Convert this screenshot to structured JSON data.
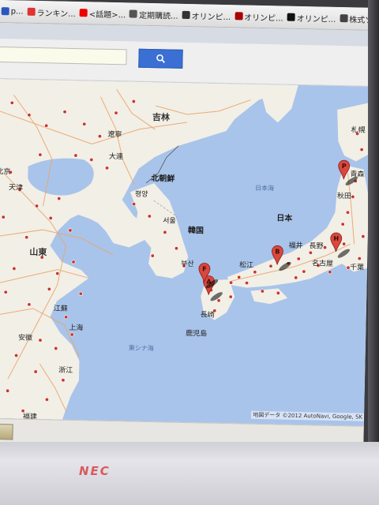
{
  "bookmarks": [
    {
      "label": "p...",
      "color": "#2b56c2"
    },
    {
      "label": "ランキン...",
      "color": "#d33"
    },
    {
      "label": "<話題>...",
      "color": "#e00"
    },
    {
      "label": "定期購読...",
      "color": "#555"
    },
    {
      "label": "オリンピ...",
      "color": "#333"
    },
    {
      "label": "オリンピ...",
      "color": "#a00"
    },
    {
      "label": "オリンピ...",
      "color": "#111"
    },
    {
      "label": "株式ソ...",
      "color": "#444"
    }
  ],
  "titlebar_text": "",
  "search": {
    "value": "",
    "placeholder": "",
    "button_icon": "magnifier-icon"
  },
  "map": {
    "countries": {
      "north_korea": "北朝鮮",
      "korea": "韓国",
      "japan": "日本"
    },
    "seas": {
      "japan_sea": "日本海",
      "east_china_sea": "東シナ海"
    },
    "places": {
      "jilin": "吉林",
      "beijing": "北京",
      "tianjin": "天津",
      "liaoning": "遼寧",
      "dalian": "大連",
      "shandong": "山東",
      "jiangsu": "江蘇",
      "shanghai": "上海",
      "anhui": "安徽",
      "zhejiang": "浙江",
      "fujian": "福建",
      "pyongyang": "평양",
      "seoul": "서울",
      "busan": "부산",
      "nagasaki": "長崎",
      "sapporo": "札幌",
      "aomori": "青森",
      "akita": "秋田",
      "fukui": "福井",
      "nagano": "長野",
      "chiba": "千葉",
      "matsue": "松江",
      "kagoshima": "鹿児島",
      "nagoya": "名古屋"
    },
    "markers": [
      {
        "letter": "A"
      },
      {
        "letter": "B"
      },
      {
        "letter": "F"
      },
      {
        "letter": "H"
      },
      {
        "letter": "P"
      }
    ],
    "attribution": "地図データ ©2012 AutoNavi, Google, SK"
  },
  "bezel_brand": "NEC",
  "colors": {
    "land": "#f2efe6",
    "sea": "#a9c4ea",
    "road": "#e9a56b",
    "city_dot": "#c9362e",
    "marker": "#d9473d"
  }
}
